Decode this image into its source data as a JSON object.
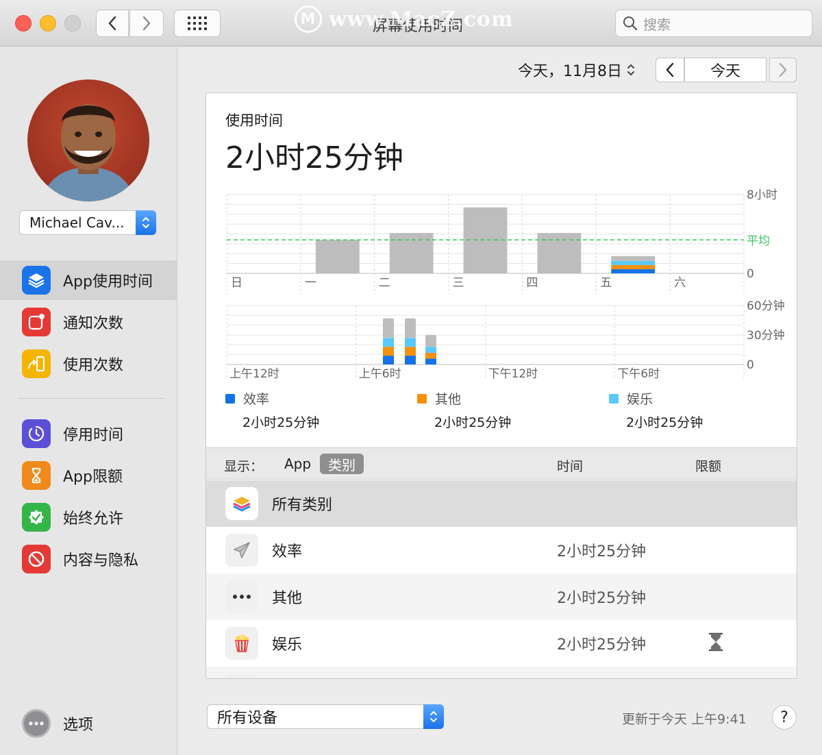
{
  "window": {
    "title": "屏幕使用时间",
    "watermark": "www.MacZ.com",
    "watermark_logo": "M",
    "search_placeholder": "搜索"
  },
  "sidebar": {
    "user_name": "Michael Cav...",
    "items": [
      {
        "label": "App使用时间",
        "icon": "layers-icon",
        "color": "#1a73e8",
        "selected": true
      },
      {
        "label": "通知次数",
        "icon": "notification-icon",
        "color": "#e53935"
      },
      {
        "label": "使用次数",
        "icon": "pickup-icon",
        "color": "#f4b400"
      },
      {
        "label": "停用时间",
        "icon": "downtime-icon",
        "color": "#5b4fd8"
      },
      {
        "label": "App限额",
        "icon": "hourglass-icon",
        "color": "#f08a1c"
      },
      {
        "label": "始终允许",
        "icon": "checkmark-icon",
        "color": "#34b548"
      },
      {
        "label": "内容与隐私",
        "icon": "restrict-icon",
        "color": "#e53935"
      }
    ],
    "options_label": "选项"
  },
  "datebar": {
    "label": "今天，11月8日",
    "today_button": "今天"
  },
  "summary": {
    "label": "使用时间",
    "total": "2小时25分钟"
  },
  "chart_data": [
    {
      "type": "bar",
      "categories": [
        "日",
        "一",
        "二",
        "三",
        "四",
        "五",
        "六"
      ],
      "series": [
        {
          "name": "效率",
          "values": [
            0,
            0,
            0,
            0,
            0,
            0.42,
            0
          ]
        },
        {
          "name": "其他",
          "values": [
            0,
            0,
            0,
            0,
            0,
            0.42,
            0
          ]
        },
        {
          "name": "娱乐",
          "values": [
            0,
            0,
            0,
            0,
            0,
            0.42,
            0
          ]
        },
        {
          "values": [
            0,
            3.4,
            4.1,
            6.7,
            4.1,
            0.5,
            0
          ]
        }
      ],
      "y_ticks": [
        "8小时",
        "0"
      ],
      "avg_label": "平均",
      "avg_value": 3.4,
      "ylim": [
        0,
        8
      ],
      "grid": true
    },
    {
      "type": "bar",
      "x_ticks": [
        "上午12时",
        "上午6时",
        "下午12时",
        "下午6时"
      ],
      "series": [
        {
          "name": "效率",
          "values": [
            9,
            9,
            6
          ]
        },
        {
          "name": "其他",
          "values": [
            9,
            9,
            6
          ]
        },
        {
          "name": "娱乐",
          "values": [
            9,
            9,
            6
          ]
        },
        {
          "values": [
            20,
            20,
            12
          ]
        }
      ],
      "y_ticks": [
        "60分钟",
        "30分钟",
        "0"
      ],
      "ylim": [
        0,
        60
      ],
      "grid": true
    }
  ],
  "legend": [
    {
      "name": "效率",
      "value": "2小时25分钟",
      "color": "#1473e6"
    },
    {
      "name": "其他",
      "value": "2小时25分钟",
      "color": "#f5900b"
    },
    {
      "name": "娱乐",
      "value": "2小时25分钟",
      "color": "#5ac8fa"
    }
  ],
  "list": {
    "show_label": "显示：",
    "seg_app": "App",
    "seg_category": "类别",
    "col_time": "时间",
    "col_limit": "限额",
    "rows": [
      {
        "name": "所有类别",
        "time": "",
        "icon": "layers-icon"
      },
      {
        "name": "效率",
        "time": "2小时25分钟",
        "icon": "paper-plane-icon"
      },
      {
        "name": "其他",
        "time": "2小时25分钟",
        "icon": "ellipsis-icon"
      },
      {
        "name": "娱乐",
        "time": "2小时25分钟",
        "icon": "popcorn-icon",
        "limit_icon": "hourglass-icon"
      }
    ]
  },
  "footer": {
    "device_select": "所有设备",
    "updated": "更新于今天 上午9:41",
    "help": "?"
  }
}
